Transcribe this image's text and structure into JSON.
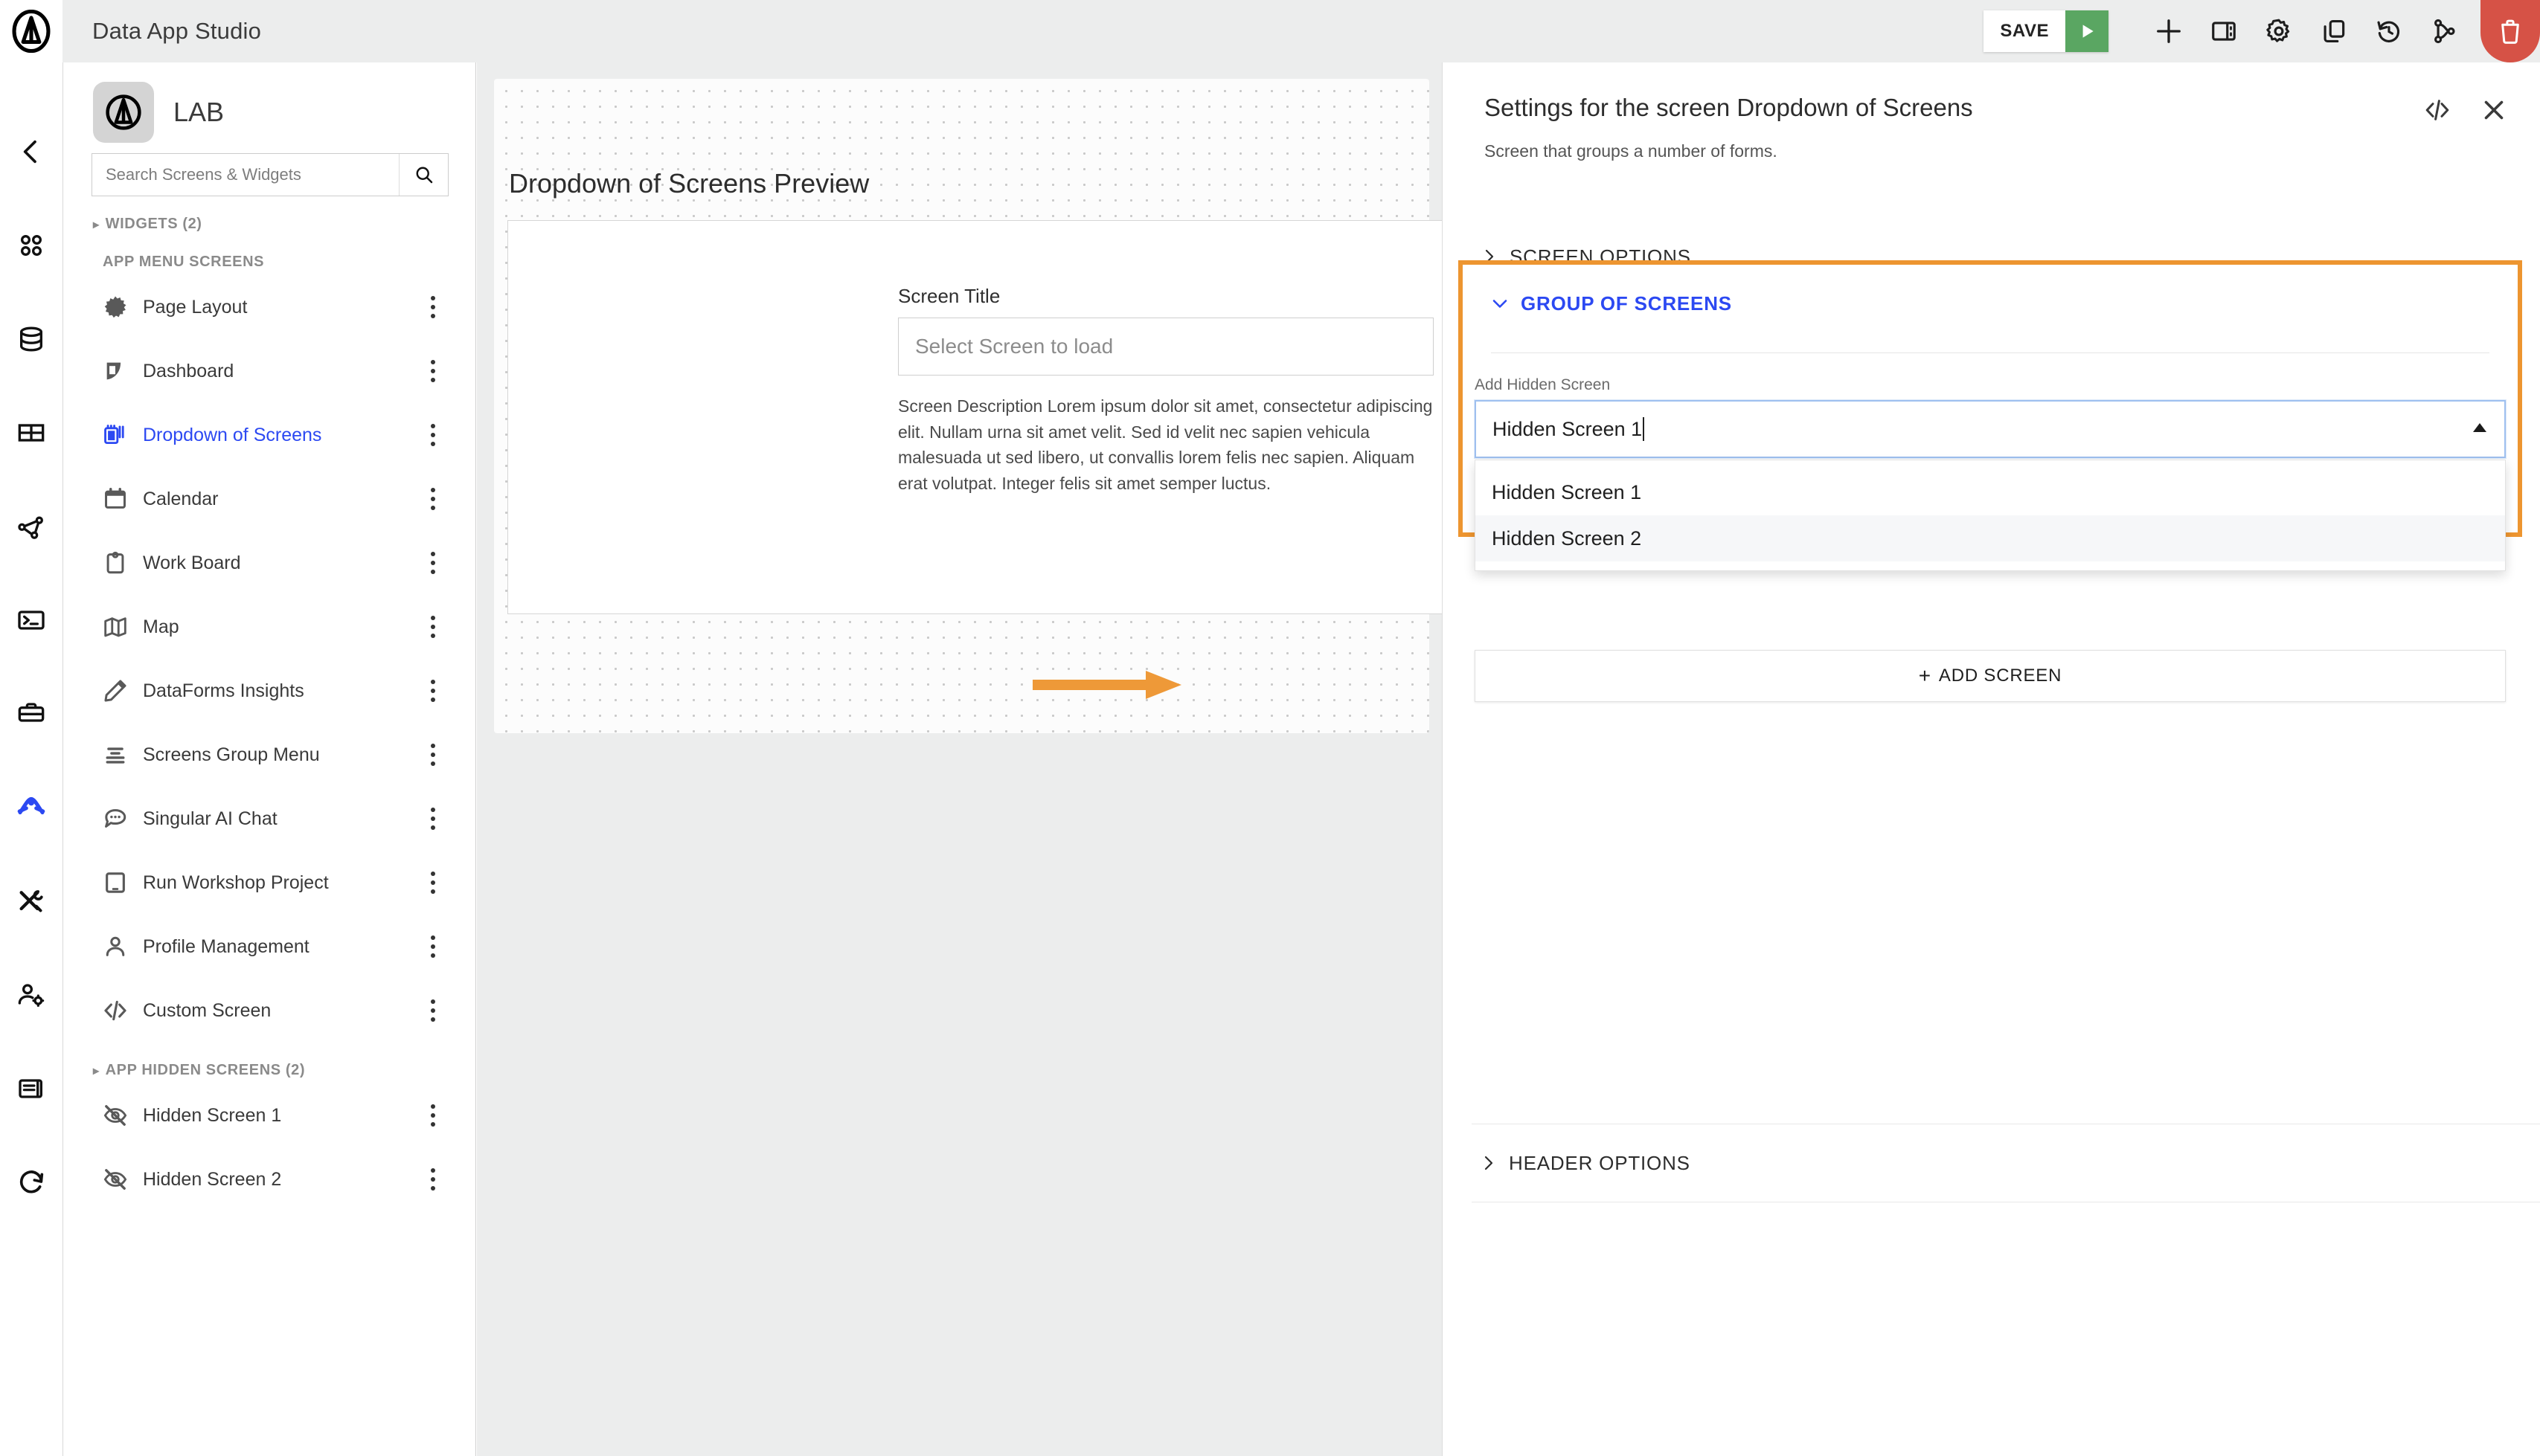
{
  "topbar": {
    "app_title": "Data App Studio",
    "save_label": "SAVE",
    "icons": [
      {
        "name": "play-run-icon",
        "label": "Run"
      },
      {
        "name": "plus-add-icon",
        "label": "Add"
      },
      {
        "name": "panel-layout-icon",
        "label": "Layout"
      },
      {
        "name": "gear-settings-icon",
        "label": "Settings"
      },
      {
        "name": "copy-duplicate-icon",
        "label": "Duplicate"
      },
      {
        "name": "history-revert-icon",
        "label": "History"
      },
      {
        "name": "branch-merge-icon",
        "label": "Branch"
      },
      {
        "name": "trash-delete-icon",
        "label": "Delete"
      }
    ]
  },
  "rail": {
    "items": [
      {
        "name": "collapse-chevron-left-icon",
        "active": false
      },
      {
        "name": "apps-grid-icon",
        "active": false
      },
      {
        "name": "database-icon",
        "active": false
      },
      {
        "name": "table-icon",
        "active": false
      },
      {
        "name": "network-graph-icon",
        "active": false
      },
      {
        "name": "terminal-console-icon",
        "active": false
      },
      {
        "name": "toolbox-icon",
        "active": false
      },
      {
        "name": "studio-active-icon",
        "active": true
      },
      {
        "name": "tools-wrench-icon",
        "active": false
      },
      {
        "name": "user-settings-icon",
        "active": false
      },
      {
        "name": "book-docs-icon",
        "active": false
      },
      {
        "name": "refresh-reload-icon",
        "active": false
      }
    ],
    "active_color": "#2c49f2"
  },
  "sidebar": {
    "lab_name": "LAB",
    "search": {
      "placeholder": "Search Screens & Widgets",
      "value": ""
    },
    "widgets_group": {
      "label": "WIDGETS (2)",
      "collapsed": true
    },
    "app_menu_label": "APP MENU SCREENS",
    "screens": [
      {
        "label": "Page Layout",
        "icon": "burst-star-icon",
        "active": false
      },
      {
        "label": "Dashboard",
        "icon": "dashboard-icon",
        "active": false
      },
      {
        "label": "Dropdown of Screens",
        "icon": "screens-stack-icon",
        "active": true
      },
      {
        "label": "Calendar",
        "icon": "calendar-icon",
        "active": false
      },
      {
        "label": "Work Board",
        "icon": "clipboard-icon",
        "active": false
      },
      {
        "label": "Map",
        "icon": "map-icon",
        "active": false
      },
      {
        "label": "DataForms Insights",
        "icon": "pencil-icon",
        "active": false
      },
      {
        "label": "Screens Group Menu",
        "icon": "menu-lines-icon",
        "active": false
      },
      {
        "label": "Singular AI Chat",
        "icon": "chat-bubble-icon",
        "active": false
      },
      {
        "label": "Run Workshop Project",
        "icon": "tablet-icon",
        "active": false
      },
      {
        "label": "Profile Management",
        "icon": "person-icon",
        "active": false
      },
      {
        "label": "Custom Screen",
        "icon": "code-brackets-icon",
        "active": false
      }
    ],
    "hidden_group": {
      "label": "APP HIDDEN SCREENS (2)",
      "collapsed": true
    },
    "hidden_screens": [
      {
        "label": "Hidden Screen 1",
        "icon": "eye-off-icon"
      },
      {
        "label": "Hidden Screen 2",
        "icon": "eye-off-icon"
      }
    ],
    "active_color": "#2c49f2"
  },
  "preview": {
    "title": "Dropdown of Screens Preview",
    "screen_title_label": "Screen Title",
    "select_placeholder": "Select Screen to load",
    "description": "Screen Description Lorem ipsum dolor sit amet, consectetur adipiscing elit. Nullam urna sit amet velit. Sed id velit nec sapien vehicula malesuada ut sed libero, ut convallis lorem felis nec sapien. Aliquam erat volutpat. Integer felis sit amet semper luctus.",
    "annotation_arrow_color": "#ee9938"
  },
  "settings": {
    "title": "Settings for the screen Dropdown of Screens",
    "subtitle": "Screen that groups a number of forms.",
    "code_icon": "code-brackets-icon",
    "close_icon": "close-x-icon",
    "sections": [
      {
        "label": "SCREEN OPTIONS",
        "open": false
      },
      {
        "label": "GROUP OF SCREENS",
        "open": true
      },
      {
        "label": "HEADER OPTIONS",
        "open": false
      }
    ],
    "group_of_screens": {
      "field_label": "Add Hidden Screen",
      "input_value": "Hidden Screen 1",
      "dropdown_open": true,
      "options": [
        {
          "label": "Hidden Screen 1",
          "highlighted": false
        },
        {
          "label": "Hidden Screen 2",
          "highlighted": true
        }
      ],
      "add_button_label": "ADD SCREEN",
      "add_button_plus": "+",
      "highlight_border_color": "#ed9530",
      "accent_color": "#2c49f2"
    }
  }
}
